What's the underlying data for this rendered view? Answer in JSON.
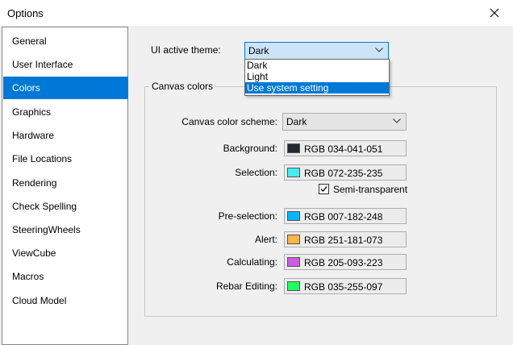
{
  "window": {
    "title": "Options"
  },
  "sidebar": {
    "items": [
      {
        "label": "General"
      },
      {
        "label": "User Interface"
      },
      {
        "label": "Colors",
        "selected": true
      },
      {
        "label": "Graphics"
      },
      {
        "label": "Hardware"
      },
      {
        "label": "File Locations"
      },
      {
        "label": "Rendering"
      },
      {
        "label": "Check Spelling"
      },
      {
        "label": "SteeringWheels"
      },
      {
        "label": "ViewCube"
      },
      {
        "label": "Macros"
      },
      {
        "label": "Cloud Model"
      }
    ]
  },
  "theme": {
    "label": "UI active theme:",
    "value": "Dark",
    "options": [
      "Dark",
      "Light",
      "Use system setting"
    ],
    "highlighted_option": "Use system setting"
  },
  "canvas": {
    "group_title": "Canvas colors",
    "scheme_label": "Canvas color scheme:",
    "scheme_value": "Dark",
    "semi_transparent_label": "Semi-transparent",
    "semi_transparent_checked": true,
    "colors": [
      {
        "label": "Background:",
        "value": "RGB 034-041-051",
        "hex": "#222933"
      },
      {
        "label": "Selection:",
        "value": "RGB 072-235-235",
        "hex": "#48ebeb"
      },
      {
        "label": "Pre-selection:",
        "value": "RGB 007-182-248",
        "hex": "#07b6f8"
      },
      {
        "label": "Alert:",
        "value": "RGB 251-181-073",
        "hex": "#fbb549"
      },
      {
        "label": "Calculating:",
        "value": "RGB 205-093-223",
        "hex": "#cd5ddf"
      },
      {
        "label": "Rebar Editing:",
        "value": "RGB 035-255-097",
        "hex": "#23ff61"
      }
    ]
  },
  "icons": {
    "close": "close-icon",
    "dropdown": "chevron-down-icon",
    "check": "checkmark-icon"
  }
}
